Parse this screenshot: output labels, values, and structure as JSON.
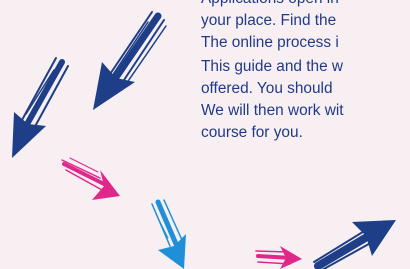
{
  "body": {
    "paragraphs": [
      {
        "lines": [
          "Applications open in",
          "your place. Find the",
          "The online process i"
        ]
      },
      {
        "lines": [
          "This guide and the w",
          "offered. You should",
          "We will then work wit",
          "course for you."
        ]
      }
    ]
  },
  "colors": {
    "background": "#f8eff3",
    "text": "#1f3a8a",
    "arrow_dark_blue": "#1e3f87",
    "arrow_pink": "#e0288a",
    "arrow_light_blue": "#1e8fd8"
  },
  "decorations": [
    "dark-blue-brush-arrow",
    "dark-blue-brush-arrow",
    "pink-brush-arrow",
    "light-blue-brush-arrow",
    "pink-brush-arrow",
    "dark-blue-brush-arrow"
  ]
}
